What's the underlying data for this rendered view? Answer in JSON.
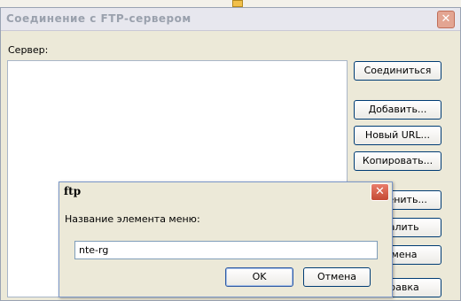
{
  "window": {
    "title": "Соединение с FTP-сервером",
    "close_glyph": "✕"
  },
  "server": {
    "label": "Сервер:"
  },
  "side_buttons": {
    "connect": "Соединиться",
    "add": "Добавить...",
    "new_url": "Новый URL...",
    "copy": "Копировать...",
    "change": "Изменить...",
    "delete": "Удалить",
    "cancel": "Отмена",
    "help": "Справка"
  },
  "dialog": {
    "title": "ftp",
    "close_glyph": "✕",
    "label": "Название элемента меню:",
    "input_value": "nte-rg",
    "ok_label": "OK",
    "cancel_label": "Отмена"
  },
  "colors": {
    "window_bg": "#ece9d8",
    "button_border": "#003c74",
    "close_red": "#c44a33"
  },
  "icons": [
    "close-icon",
    "folder-icon"
  ]
}
